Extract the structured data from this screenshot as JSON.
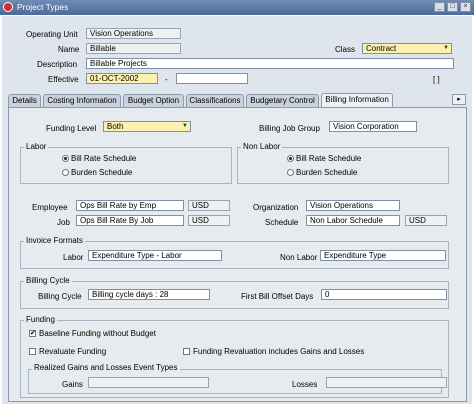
{
  "window": {
    "title": "Project Types",
    "controls": [
      "_",
      "□",
      "×"
    ]
  },
  "header": {
    "operating_unit": {
      "label": "Operating Unit",
      "value": "Vision Operations"
    },
    "name": {
      "label": "Name",
      "value": "Billable"
    },
    "class": {
      "label": "Class",
      "value": "Contract"
    },
    "description": {
      "label": "Description",
      "value": "Billable Projects"
    },
    "effective": {
      "label": "Effective",
      "from": "01-OCT-2002",
      "separator": "-",
      "to": ""
    },
    "bracket": "[ ]"
  },
  "tabs": [
    {
      "label": "Details"
    },
    {
      "label": "Costing Information"
    },
    {
      "label": "Budget Option"
    },
    {
      "label": "Classifications"
    },
    {
      "label": "Budgetary Control"
    },
    {
      "label": "Billing Information",
      "active": true
    }
  ],
  "tab_scroll": "▸",
  "billing": {
    "funding_level": {
      "label": "Funding Level",
      "value": "Both"
    },
    "billing_job_group": {
      "label": "Billing Job Group",
      "value": "Vision Corporation"
    },
    "labor_group": {
      "title": "Labor",
      "options": [
        {
          "label": "Bill Rate Schedule",
          "selected": true
        },
        {
          "label": "Burden Schedule",
          "selected": false
        }
      ]
    },
    "non_labor_group": {
      "title": "Non Labor",
      "options": [
        {
          "label": "Bill Rate Schedule",
          "selected": true
        },
        {
          "label": "Burden Schedule",
          "selected": false
        }
      ]
    },
    "employee": {
      "label": "Employee",
      "value": "Ops Bill Rate by Emp",
      "currency": "USD"
    },
    "job": {
      "label": "Job",
      "value": "Ops Bill Rate By Job",
      "currency": "USD"
    },
    "organization": {
      "label": "Organization",
      "value": "Vision Operations"
    },
    "schedule": {
      "label": "Schedule",
      "value": "Non Labor Schedule",
      "currency": "USD"
    },
    "invoice_formats": {
      "title": "Invoice Formats",
      "labor": {
        "label": "Labor",
        "value": "Expenditure Type - Labor"
      },
      "non_labor": {
        "label": "Non Labor",
        "value": "Expenditure Type"
      }
    },
    "billing_cycle_group": {
      "title": "Billing Cycle",
      "cycle": {
        "label": "Billing Cycle",
        "value": "Billing cycle days : 28"
      },
      "offset": {
        "label": "First Bill Offset Days",
        "value": "0"
      }
    },
    "funding": {
      "title": "Funding",
      "baseline": {
        "label": "Baseline Funding without Budget",
        "checked": true
      },
      "revaluate": {
        "label": "Revaluate Funding",
        "checked": false
      },
      "revaluation_gains": {
        "label": "Funding Revaluation includes Gains and Losses",
        "checked": false
      },
      "realized": {
        "title": "Realized Gains and Losses Event Types",
        "gains": {
          "label": "Gains",
          "value": ""
        },
        "losses": {
          "label": "Losses",
          "value": ""
        }
      }
    }
  }
}
